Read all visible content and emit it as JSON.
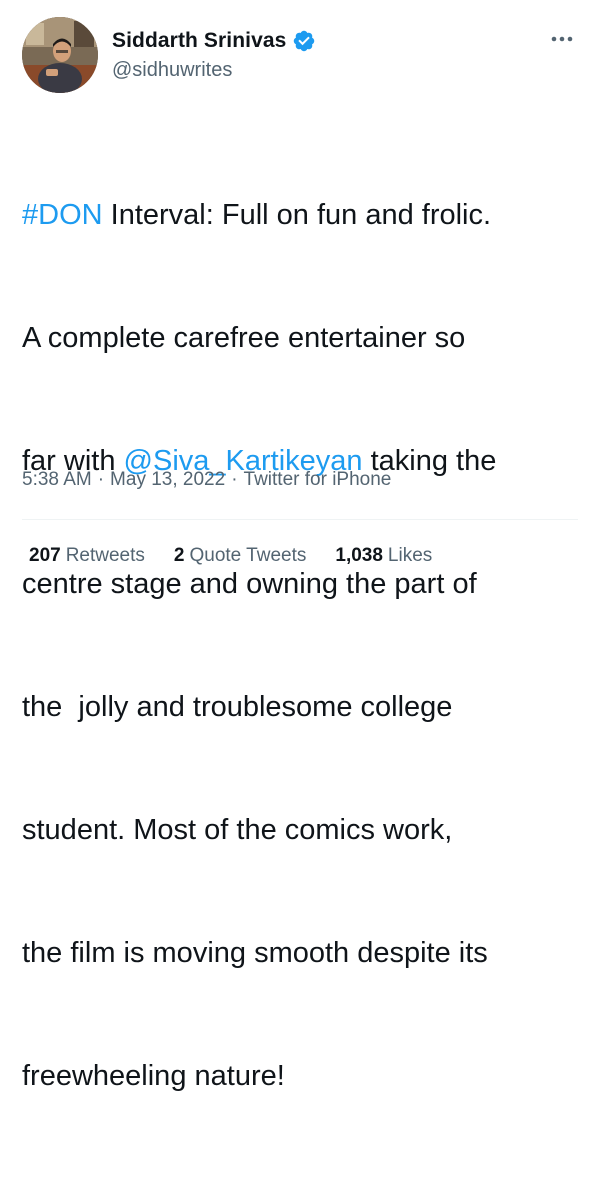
{
  "author": {
    "display_name": "Siddarth Srinivas",
    "handle": "@sidhuwrites",
    "verified_icon": "verified-badge-icon"
  },
  "menu": {
    "icon": "more-options-icon"
  },
  "tweet": {
    "hashtag": "#DON",
    "mention": "@Siva_Kartikeyan",
    "line1_rest": " Interval: Full on fun and frolic.",
    "line2": "A complete carefree entertainer so",
    "line3_before": "far with ",
    "line3_after": " taking the",
    "line4": "centre stage and owning the part of",
    "line5": "the  jolly and troublesome college",
    "line6": "student. Most of the comics work,",
    "line7": "the film is moving smooth despite its",
    "line8": "freewheeling nature!"
  },
  "meta": {
    "time": "5:38 AM",
    "separator1": "·",
    "date": "May 13, 2022",
    "separator2": "·",
    "source": "Twitter for iPhone"
  },
  "stats": {
    "retweets_count": "207",
    "retweets_label": "Retweets",
    "quotes_count": "2",
    "quotes_label": "Quote Tweets",
    "likes_count": "1,038",
    "likes_label": "Likes"
  },
  "colors": {
    "link": "#1d9bf0",
    "text": "#0f1419",
    "secondary": "#536471",
    "divider": "#eff3f4"
  }
}
